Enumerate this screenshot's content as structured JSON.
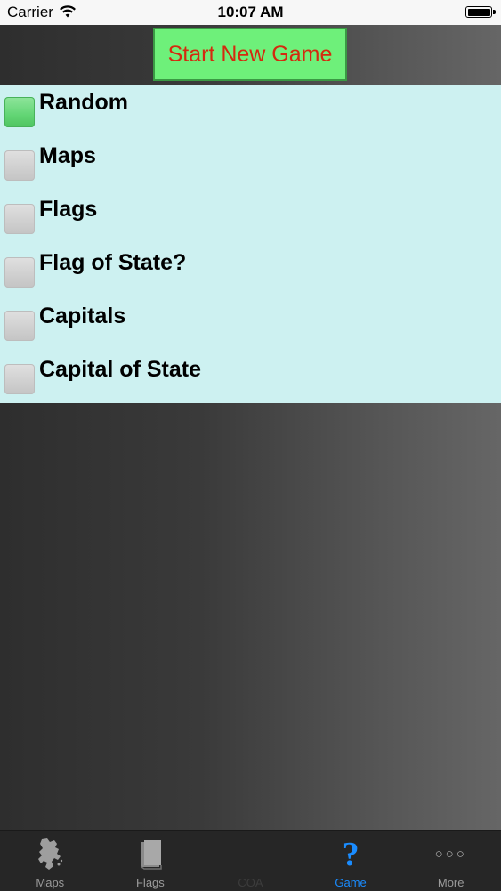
{
  "status_bar": {
    "carrier": "Carrier",
    "time": "10:07 AM"
  },
  "start_button": {
    "label": "Start New Game",
    "background": "#6ef07a",
    "text_color": "#d42a0f"
  },
  "options": [
    {
      "label": "Random",
      "selected": true
    },
    {
      "label": "Maps",
      "selected": false
    },
    {
      "label": "Flags",
      "selected": false
    },
    {
      "label": "Flag of State?",
      "selected": false
    },
    {
      "label": "Capitals",
      "selected": false
    },
    {
      "label": "Capital of State",
      "selected": false
    }
  ],
  "tab_bar": {
    "tabs": [
      {
        "label": "Maps",
        "icon": "map-icon",
        "state": "normal"
      },
      {
        "label": "Flags",
        "icon": "flag-book-icon",
        "state": "normal"
      },
      {
        "label": "COA",
        "icon": "coat-of-arms-icon",
        "state": "disabled"
      },
      {
        "label": "Game",
        "icon": "question-icon",
        "state": "active"
      },
      {
        "label": "More",
        "icon": "more-icon",
        "state": "normal"
      }
    ],
    "active_color": "#1a8cff"
  }
}
